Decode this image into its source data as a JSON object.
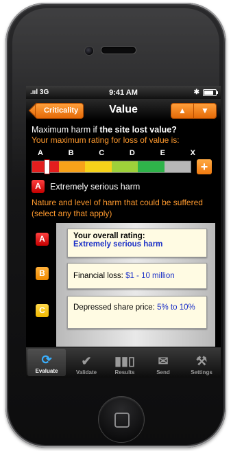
{
  "status": {
    "signal": ".ııl 3G",
    "time": "9:41 AM",
    "bluetooth": "✱"
  },
  "nav": {
    "back_label": "Criticality",
    "title": "Value",
    "up_icon": "▲",
    "down_icon": "▼"
  },
  "content": {
    "question_prefix": "Maximum harm if ",
    "question_bold": "the site lost value?",
    "max_rating_label": "Your maximum rating for loss of value is:",
    "scale_letters": [
      "A",
      "B",
      "C",
      "D",
      "E",
      "X"
    ],
    "scale_colors": [
      "#e41e1e",
      "#f7a21a",
      "#f6d21a",
      "#9ed13a",
      "#2fb44a",
      "#b7b7b7"
    ],
    "plus_label": "+",
    "rating_badge": "A",
    "rating_text": "Extremely serious harm",
    "nature_text": "Nature and level of harm that could be suffered (select any that apply)"
  },
  "cards": {
    "overall_label": "Your overall rating:",
    "overall_value": "Extremely serious harm",
    "badge_a": "A",
    "badge_b": "B",
    "badge_c": "C",
    "financial_label": "Financial loss: ",
    "financial_value": "$1 - 10 million",
    "share_label": "Depressed share price: ",
    "share_value": "5% to 10%"
  },
  "tabs": [
    {
      "label": "Evaluate",
      "icon": "evaluate-icon"
    },
    {
      "label": "Validate",
      "icon": "checkmark-icon"
    },
    {
      "label": "Results",
      "icon": "bar-chart-icon"
    },
    {
      "label": "Send",
      "icon": "envelope-icon"
    },
    {
      "label": "Settings",
      "icon": "wrench-icon"
    }
  ]
}
